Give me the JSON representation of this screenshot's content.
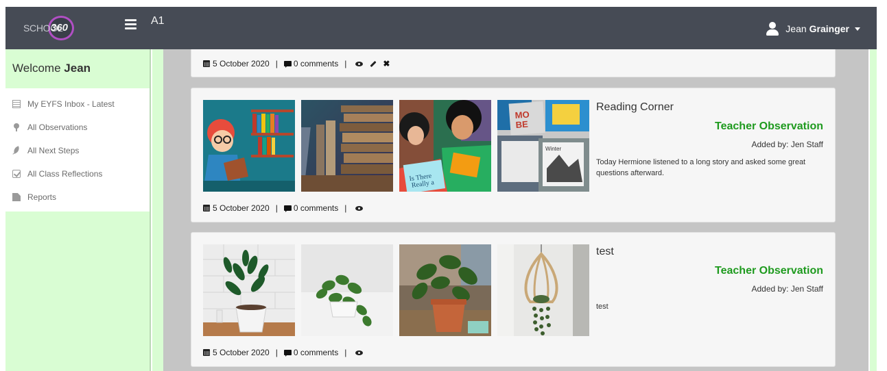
{
  "header": {
    "logo_text": "SCHOOL",
    "logo_number": "360",
    "class_name": "A1",
    "user_first": "Jean",
    "user_last": "Grainger"
  },
  "sidebar": {
    "welcome_prefix": "Welcome",
    "welcome_name": "Jean",
    "items": [
      {
        "label": "My EYFS Inbox - Latest",
        "icon": "inbox-list-icon"
      },
      {
        "label": "All Observations",
        "icon": "pin-icon"
      },
      {
        "label": "All Next Steps",
        "icon": "leaf-icon"
      },
      {
        "label": "All Class Reflections",
        "icon": "check-square-icon"
      },
      {
        "label": "Reports",
        "icon": "file-icon"
      }
    ]
  },
  "posts": [
    {
      "date": "5 October 2020",
      "comments": "0 comments"
    },
    {
      "title": "Reading Corner",
      "type": "Teacher Observation",
      "added_by": "Added by: Jen Staff",
      "description": "Today Hermione listened to a long story and asked some great questions afterward.",
      "date": "5 October 2020",
      "comments": "0 comments",
      "images": [
        "girl-reading-illustration",
        "stacked-books",
        "girls-reading-painting",
        "picture-books-pile"
      ]
    },
    {
      "title": "test",
      "type": "Teacher Observation",
      "added_by": "Added by: Jen Staff",
      "description": "test",
      "date": "5 October 2020",
      "comments": "0 comments",
      "images": [
        "potted-zz-plant",
        "pothos-plant",
        "terracotta-pot-plant",
        "hanging-planter"
      ]
    }
  ],
  "colors": {
    "topbar": "#464b55",
    "sidebar_bg": "#d9fdd3",
    "feed_bg": "#c5c5c5",
    "observation_green": "#1e9a1e"
  }
}
